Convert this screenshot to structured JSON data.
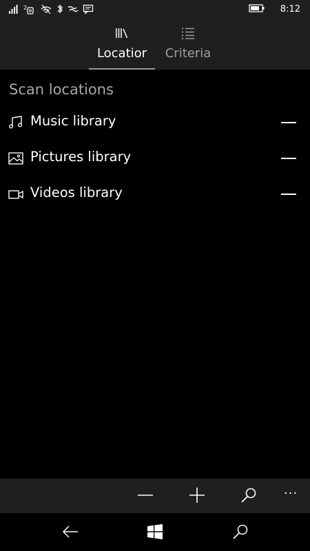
{
  "status": {
    "time": "8:12",
    "icons": [
      "signal-icon",
      "sim-2-icon",
      "wifi-icon",
      "bluetooth-icon",
      "vibrate-icon",
      "message-icon",
      "battery-icon"
    ]
  },
  "pivot": {
    "tabs": [
      {
        "label": "Locatior",
        "icon": "library-icon",
        "selected": true
      },
      {
        "label": "Criteria",
        "icon": "list-icon",
        "selected": false
      }
    ]
  },
  "main": {
    "section_title": "Scan locations",
    "items": [
      {
        "label": "Music library",
        "icon": "music-note-icon"
      },
      {
        "label": "Pictures library",
        "icon": "picture-icon"
      },
      {
        "label": "Videos library",
        "icon": "video-camera-icon"
      }
    ]
  },
  "appbar": {
    "buttons": [
      "remove-icon",
      "add-icon",
      "search-icon"
    ],
    "more": "···"
  },
  "navbar": {
    "buttons": [
      "back-icon",
      "windows-start-icon",
      "search-icon"
    ]
  },
  "colors": {
    "background": "#000000",
    "chrome": "#1f1f1f",
    "text": "#ffffff",
    "muted": "#a8a8a8"
  }
}
